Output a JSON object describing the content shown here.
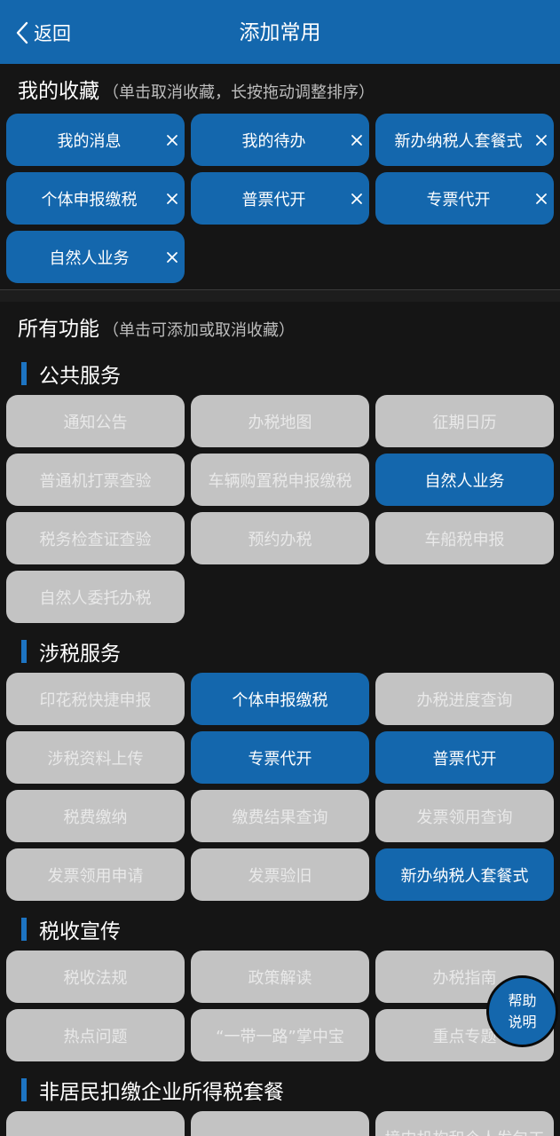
{
  "header": {
    "back_label": "返回",
    "title": "添加常用"
  },
  "favorites": {
    "title": "我的收藏",
    "hint": "（单击取消收藏，长按拖动调整排序）",
    "items": [
      "我的消息",
      "我的待办",
      "新办纳税人套餐式",
      "个体申报缴税",
      "普票代开",
      "专票代开",
      "自然人业务"
    ]
  },
  "all_functions": {
    "title": "所有功能",
    "hint": "（单击可添加或取消收藏）",
    "categories": [
      {
        "name": "公共服务",
        "items": [
          {
            "label": "通知公告",
            "selected": false
          },
          {
            "label": "办税地图",
            "selected": false
          },
          {
            "label": "征期日历",
            "selected": false
          },
          {
            "label": "普通机打票查验",
            "selected": false
          },
          {
            "label": "车辆购置税申报缴税",
            "selected": false
          },
          {
            "label": "自然人业务",
            "selected": true
          },
          {
            "label": "税务检查证查验",
            "selected": false
          },
          {
            "label": "预约办税",
            "selected": false
          },
          {
            "label": "车船税申报",
            "selected": false
          },
          {
            "label": "自然人委托办税",
            "selected": false
          }
        ]
      },
      {
        "name": "涉税服务",
        "items": [
          {
            "label": "印花税快捷申报",
            "selected": false
          },
          {
            "label": "个体申报缴税",
            "selected": true
          },
          {
            "label": "办税进度查询",
            "selected": false
          },
          {
            "label": "涉税资料上传",
            "selected": false
          },
          {
            "label": "专票代开",
            "selected": true
          },
          {
            "label": "普票代开",
            "selected": true
          },
          {
            "label": "税费缴纳",
            "selected": false
          },
          {
            "label": "缴费结果查询",
            "selected": false
          },
          {
            "label": "发票领用查询",
            "selected": false
          },
          {
            "label": "发票领用申请",
            "selected": false
          },
          {
            "label": "发票验旧",
            "selected": false
          },
          {
            "label": "新办纳税人套餐式",
            "selected": true
          }
        ]
      },
      {
        "name": "税收宣传",
        "items": [
          {
            "label": "税收法规",
            "selected": false
          },
          {
            "label": "政策解读",
            "selected": false
          },
          {
            "label": "办税指南",
            "selected": false
          },
          {
            "label": "热点问题",
            "selected": false
          },
          {
            "label": "“一带一路”掌中宝",
            "selected": false
          },
          {
            "label": "重点专题",
            "selected": false
          }
        ]
      },
      {
        "name": "非居民扣缴企业所得税套餐",
        "items": [
          {
            "label": "",
            "selected": false
          },
          {
            "label": "",
            "selected": false
          },
          {
            "label": "境内机构和个人发包工",
            "selected": false
          }
        ]
      }
    ]
  },
  "help": {
    "line1": "帮助",
    "line2": "说明"
  },
  "colors": {
    "header": "#1467ad",
    "chip_selected": "#1467ad",
    "chip_unselected": "#c3c3c3",
    "background": "#151515"
  }
}
